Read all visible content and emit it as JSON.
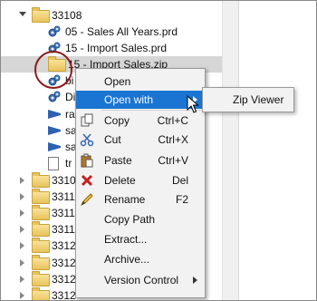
{
  "tree": {
    "rows": [
      {
        "label": "33108",
        "kind": "folder",
        "arrow": "down"
      },
      {
        "label": "05 - Sales All Years.prd",
        "kind": "gear"
      },
      {
        "label": "15 - Import Sales.prd",
        "kind": "gear"
      },
      {
        "label": "15 - Import Sales.zip",
        "kind": "folder",
        "selected": true
      },
      {
        "label": "bi",
        "kind": "gear"
      },
      {
        "label": "Di",
        "kind": "gear"
      },
      {
        "label": "ra",
        "kind": "funnel"
      },
      {
        "label": "sa",
        "kind": "funnel"
      },
      {
        "label": "sa",
        "kind": "funnel"
      },
      {
        "label": "tr",
        "kind": "doc"
      },
      {
        "label": "3310",
        "kind": "folder",
        "arrow": "right"
      },
      {
        "label": "3311",
        "kind": "folder",
        "arrow": "right"
      },
      {
        "label": "3311",
        "kind": "folder",
        "arrow": "right"
      },
      {
        "label": "3311",
        "kind": "folder",
        "arrow": "right"
      },
      {
        "label": "3312",
        "kind": "folder",
        "arrow": "right"
      },
      {
        "label": "3312",
        "kind": "folder",
        "arrow": "right"
      },
      {
        "label": "3312",
        "kind": "folder",
        "arrow": "right"
      },
      {
        "label": "3312",
        "kind": "folder",
        "arrow": "right"
      }
    ]
  },
  "context_menu": {
    "items": [
      {
        "label": "Open"
      },
      {
        "label": "Open with",
        "submenu": true,
        "highlighted": true
      },
      {
        "separator": true
      },
      {
        "label": "Copy",
        "shortcut": "Ctrl+C",
        "icon": "copy-icon"
      },
      {
        "label": "Cut",
        "shortcut": "Ctrl+X",
        "icon": "scissors-icon"
      },
      {
        "label": "Paste",
        "shortcut": "Ctrl+V",
        "icon": "paste-icon"
      },
      {
        "label": "Delete",
        "shortcut": "Del",
        "icon": "delete-x-icon"
      },
      {
        "label": "Rename",
        "shortcut": "F2",
        "icon": "pencil-icon"
      },
      {
        "label": "Copy Path"
      },
      {
        "label": "Extract..."
      },
      {
        "label": "Archive..."
      },
      {
        "label": "Version Control",
        "submenu": true
      }
    ]
  },
  "submenu": {
    "label": "Zip Viewer"
  },
  "colors": {
    "highlight": "#1a75d2",
    "selection": "#d6d6d6",
    "circle": "#8b1a1a"
  }
}
